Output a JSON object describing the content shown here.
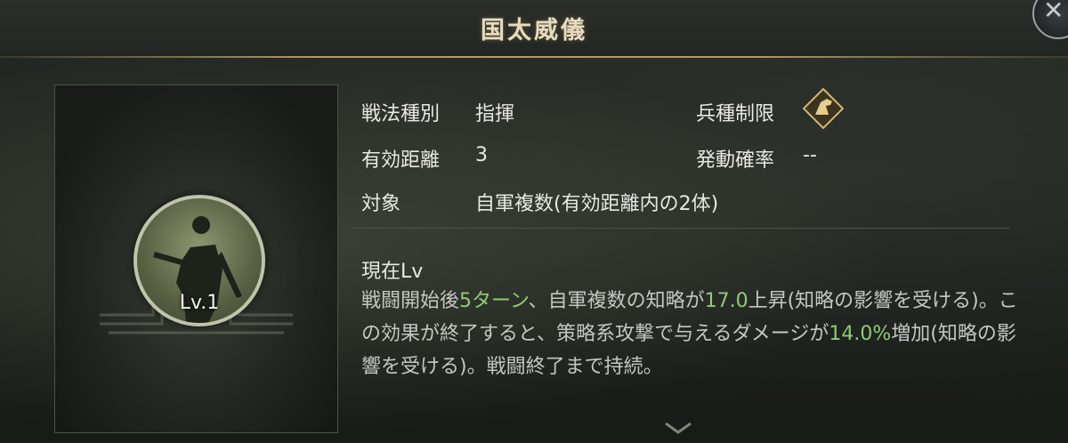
{
  "header": {
    "title": "国太威儀",
    "close_icon": "close-icon"
  },
  "portrait": {
    "level": "Lv.1",
    "icon": "warrior-silhouette-icon"
  },
  "info": {
    "type_label": "戦法種別",
    "type_value": "指揮",
    "troop_label": "兵種制限",
    "troop_icon": "horse-head-icon",
    "range_label": "有効距離",
    "range_value": "3",
    "rate_label": "発動確率",
    "rate_value": "--",
    "target_label": "対象",
    "target_value": "自軍複数(有効距離内の2体)"
  },
  "description": {
    "title": "現在Lv",
    "parts": [
      "戦闘開始後",
      "5ターン",
      "、自軍複数の知略が",
      "17.0",
      "上昇(知略の影響を受ける)。この効果が終了すると、策略系攻撃で与えるダメージが",
      "14.0%",
      "増加(知略の影響を受ける)。戦闘終了まで持続。"
    ]
  },
  "colors": {
    "accent_gold": "#b39a63",
    "highlight_green": "#8ecb76"
  }
}
